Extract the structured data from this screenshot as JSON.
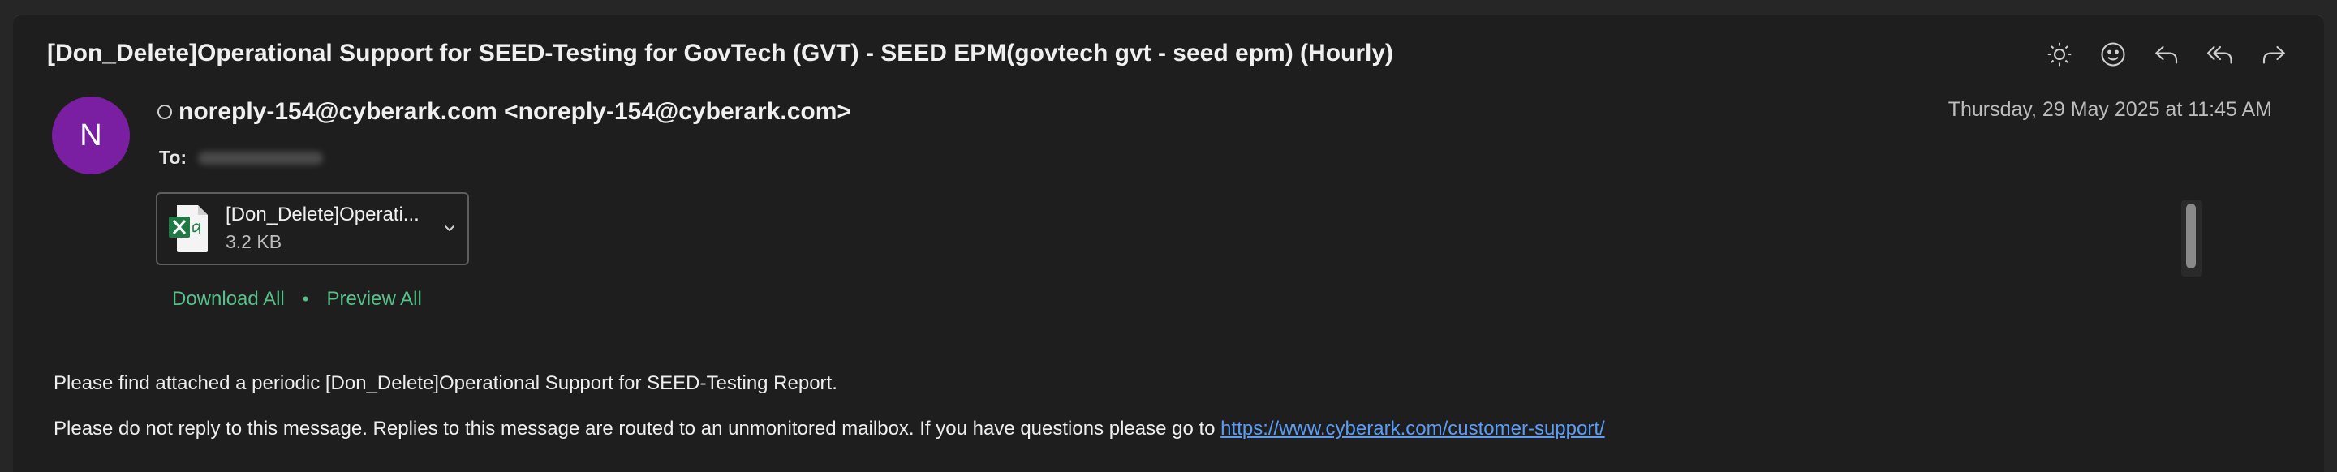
{
  "email": {
    "subject": "[Don_Delete]Operational Support for SEED-Testing for GovTech (GVT) - SEED EPM(govtech gvt - seed epm) (Hourly)",
    "sender_initial": "N",
    "sender": "noreply-154@cyberark.com <noreply-154@cyberark.com>",
    "date": "Thursday, 29 May 2025 at 11:45 AM",
    "to_label": "To:",
    "attachment": {
      "name": "[Don_Delete]Operati...",
      "size": "3.2 KB",
      "icon": "excel-file-icon"
    },
    "download_all": "Download All",
    "separator": "•",
    "preview_all": "Preview All",
    "body_line1": "Please find attached a periodic [Don_Delete]Operational Support for SEED-Testing Report.",
    "body_line2_text": "Please do not reply to this message. Replies to this message are routed to an unmonitored mailbox. If you have questions please go to ",
    "body_link": "https://www.cyberark.com/customer-support/"
  },
  "toolbar": {
    "icons": [
      "brightness-icon",
      "emoji-icon",
      "reply-icon",
      "reply-all-icon",
      "forward-icon"
    ]
  },
  "colors": {
    "background": "#1e1e1e",
    "avatar": "#7b1fa2",
    "accent_green": "#56c08a",
    "link_blue": "#5b9cf4"
  }
}
